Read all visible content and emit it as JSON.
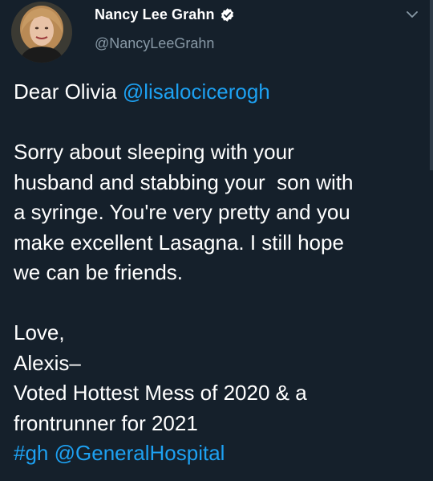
{
  "colors": {
    "background": "#15202b",
    "text": "#ffffff",
    "secondary_text": "#8899a6",
    "link": "#1da1f2",
    "verified_badge": "#ffffff"
  },
  "author": {
    "display_name": "Nancy Lee Grahn",
    "handle": "@NancyLeeGrahn",
    "verified_icon": "verified-badge-icon",
    "menu_icon": "chevron-down-icon"
  },
  "tweet": {
    "greeting_prefix": "Dear Olivia ",
    "greeting_mention": "@lisalocicerogh",
    "para1": [
      "Sorry about sleeping with your",
      "husband and stabbing your  son with",
      "a syringe. You're very pretty and you",
      "make excellent Lasagna. I still hope",
      "we can be friends."
    ],
    "signoff": [
      "Love,",
      "Alexis–",
      "Voted Hottest Mess of 2020 & a",
      "frontrunner for 2021"
    ],
    "hashtag": "#gh",
    "final_mention": "@GeneralHospital"
  }
}
